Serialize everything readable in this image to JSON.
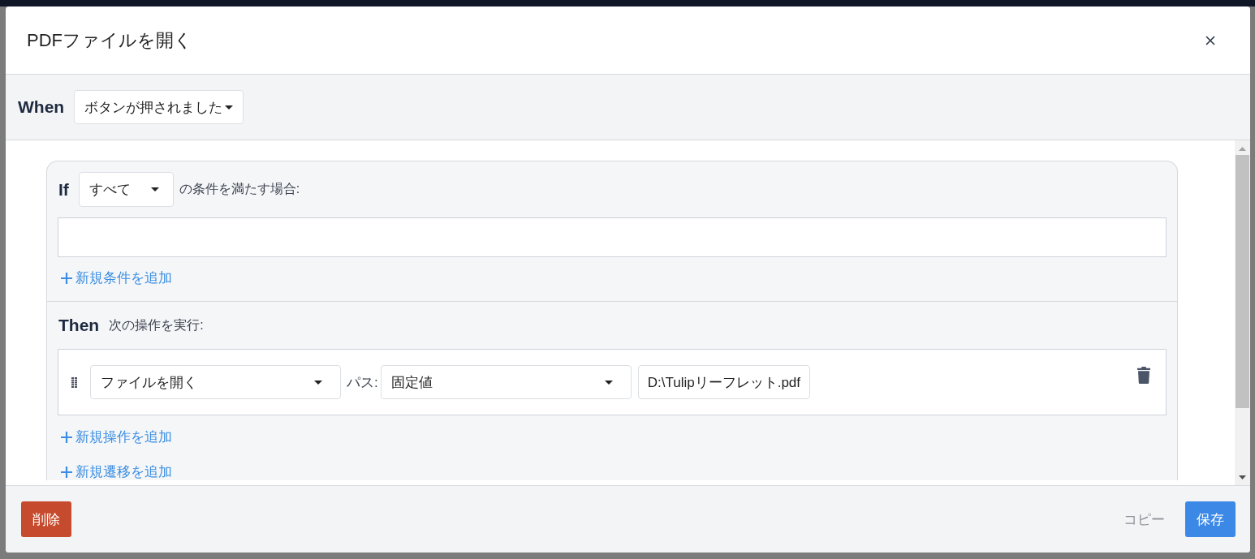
{
  "dialog": {
    "title": "PDFファイルを開く"
  },
  "when": {
    "label": "When",
    "trigger": "ボタンが押されました"
  },
  "if": {
    "label": "If",
    "match": "すべて",
    "suffix": "の条件を満たす場合:",
    "add_condition": "新規条件を追加"
  },
  "then": {
    "label": "Then",
    "suffix": "次の操作を実行:",
    "actions": [
      {
        "action": "ファイルを開く",
        "path_label": "パス:",
        "path_mode": "固定値",
        "path_value": "D:\\Tulipリーフレット.pdf"
      }
    ],
    "add_action": "新規操作を追加",
    "add_transition": "新規遷移を追加"
  },
  "footer": {
    "delete": "削除",
    "copy": "コピー",
    "save": "保存"
  }
}
